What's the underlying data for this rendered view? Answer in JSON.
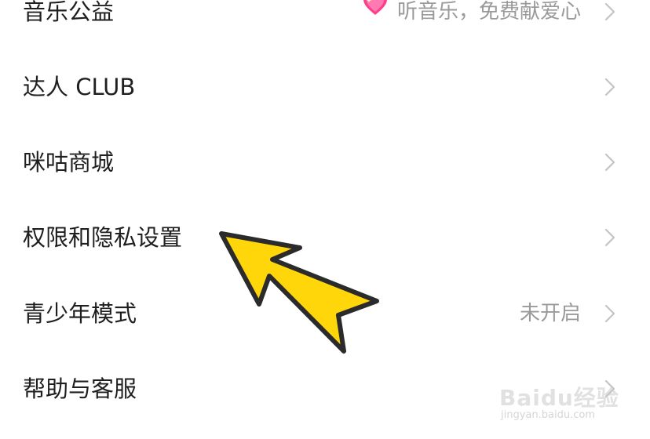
{
  "menu": {
    "items": [
      {
        "label": "音乐公益",
        "value": "听音乐，免费献爱心",
        "icon": "sparkling-heart-icon"
      },
      {
        "label": "达人 CLUB",
        "value": ""
      },
      {
        "label": "咪咕商城",
        "value": ""
      },
      {
        "label": "权限和隐私设置",
        "value": ""
      },
      {
        "label": "青少年模式",
        "value": "未开启"
      },
      {
        "label": "帮助与客服",
        "value": ""
      }
    ]
  },
  "annotation": {
    "icon": "yellow-arrow-pointer",
    "color": "#FFD60A"
  },
  "watermark": {
    "logo": "Baidu经验",
    "url": "jingyan.baidu.com"
  },
  "colors": {
    "label": "#1f1f1f",
    "value": "#9a9a9a",
    "chevron": "#c4c4c4",
    "heart": "#ff3d8b"
  }
}
